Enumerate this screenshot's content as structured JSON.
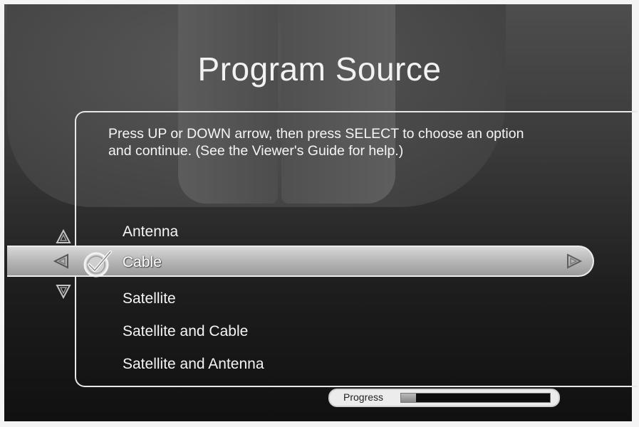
{
  "title": "Program Source",
  "instructions": "Press UP or DOWN arrow, then press SELECT to choose an option and continue. (See the Viewer's Guide for help.)",
  "options": [
    {
      "label": "Antenna",
      "selected": false
    },
    {
      "label": "Cable",
      "selected": true
    },
    {
      "label": "Satellite",
      "selected": false
    },
    {
      "label": "Satellite and Cable",
      "selected": false
    },
    {
      "label": "Satellite and Antenna",
      "selected": false
    }
  ],
  "progress": {
    "label": "Progress",
    "fraction": 0.1
  },
  "icons": {
    "up": "up-arrow-icon",
    "down": "down-arrow-icon",
    "left": "left-arrow-icon",
    "right": "right-arrow-icon",
    "selected": "checkmark-icon"
  },
  "colors": {
    "selection_bar": "#b9b9b9",
    "text": "#f5f5f5"
  }
}
